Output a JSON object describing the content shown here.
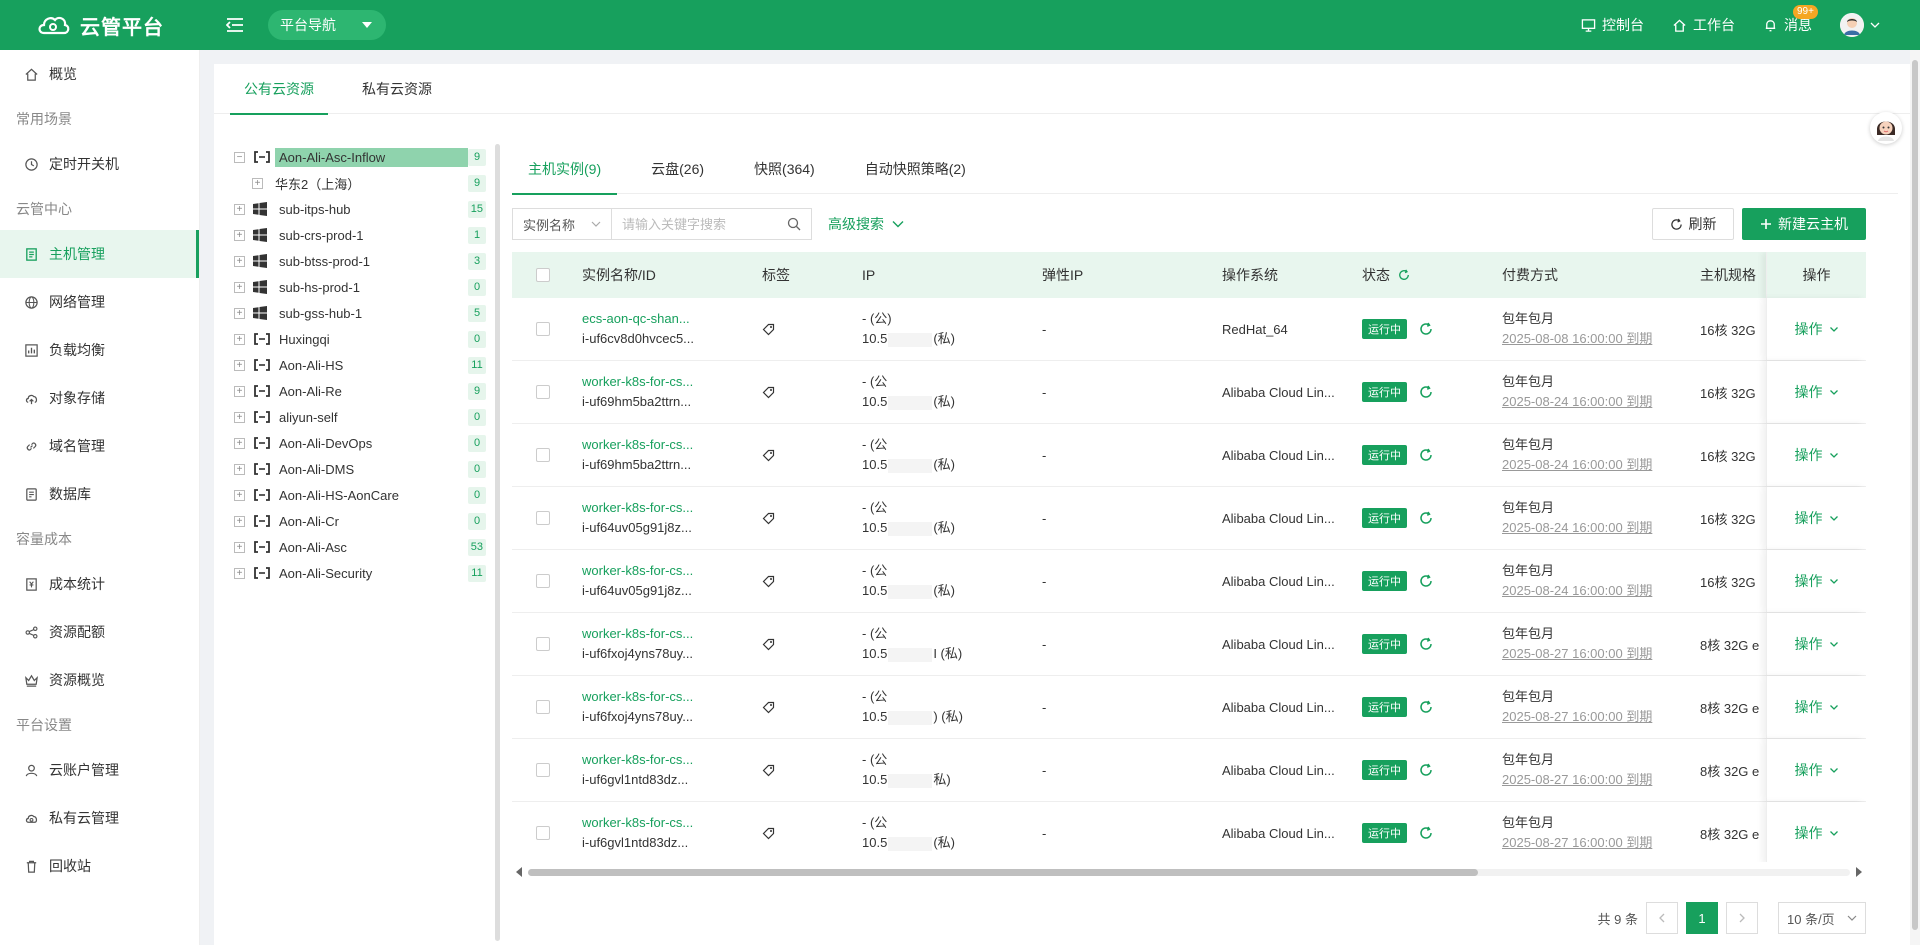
{
  "app": {
    "title": "云管平台",
    "nav_dropdown": "平台导航"
  },
  "top_links": {
    "console": "控制台",
    "workbench": "工作台",
    "messages": "消息",
    "badge": "99+"
  },
  "sidebar": {
    "overview": "概览",
    "group1": "常用场景",
    "scheduled": "定时开关机",
    "group2": "云管中心",
    "host_mgmt": "主机管理",
    "network": "网络管理",
    "lb": "负载均衡",
    "oss": "对象存储",
    "domain": "域名管理",
    "db": "数据库",
    "group3": "容量成本",
    "cost": "成本统计",
    "quota": "资源配额",
    "res_overview": "资源概览",
    "group4": "平台设置",
    "account": "云账户管理",
    "private": "私有云管理",
    "recycle": "回收站"
  },
  "main_tabs": {
    "public": "公有云资源",
    "private": "私有云资源"
  },
  "tree": [
    {
      "label": "Aon-Ali-Asc-Inflow",
      "count": "9",
      "icon": "aliyun-icon",
      "pm": "−"
    },
    {
      "label": "华东2（上海）",
      "count": "9",
      "icon": "",
      "pm": "+"
    },
    {
      "label": "sub-itps-hub",
      "count": "15",
      "icon": "windows-icon",
      "pm": "+"
    },
    {
      "label": "sub-crs-prod-1",
      "count": "1",
      "icon": "windows-icon",
      "pm": "+"
    },
    {
      "label": "sub-btss-prod-1",
      "count": "3",
      "icon": "windows-icon",
      "pm": "+"
    },
    {
      "label": "sub-hs-prod-1",
      "count": "0",
      "icon": "windows-icon",
      "pm": "+"
    },
    {
      "label": "sub-gss-hub-1",
      "count": "5",
      "icon": "windows-icon",
      "pm": "+"
    },
    {
      "label": "Huxingqi",
      "count": "0",
      "icon": "aliyun-icon",
      "pm": "+"
    },
    {
      "label": "Aon-Ali-HS",
      "count": "11",
      "icon": "aliyun-icon",
      "pm": "+"
    },
    {
      "label": "Aon-Ali-Re",
      "count": "9",
      "icon": "aliyun-icon",
      "pm": "+"
    },
    {
      "label": "aliyun-self",
      "count": "0",
      "icon": "aliyun-icon",
      "pm": "+"
    },
    {
      "label": "Aon-Ali-DevOps",
      "count": "0",
      "icon": "aliyun-icon",
      "pm": "+"
    },
    {
      "label": "Aon-Ali-DMS",
      "count": "0",
      "icon": "aliyun-icon",
      "pm": "+"
    },
    {
      "label": "Aon-Ali-HS-AonCare",
      "count": "0",
      "icon": "aliyun-icon",
      "pm": "+"
    },
    {
      "label": "Aon-Ali-Cr",
      "count": "0",
      "icon": "aliyun-icon",
      "pm": "+"
    },
    {
      "label": "Aon-Ali-Asc",
      "count": "53",
      "icon": "aliyun-icon",
      "pm": "+"
    },
    {
      "label": "Aon-Ali-Security",
      "count": "11",
      "icon": "aliyun-icon",
      "pm": "+"
    }
  ],
  "inner_tabs": {
    "host": "主机实例(9)",
    "disk": "云盘(26)",
    "snapshot": "快照(364)",
    "policy": "自动快照策略(2)"
  },
  "toolbar": {
    "select": "实例名称",
    "placeholder": "请输入关键字搜索",
    "advanced": "高级搜索",
    "refresh": "刷新",
    "new_host": "新建云主机"
  },
  "table": {
    "headers": {
      "name": "实例名称/ID",
      "tag": "标签",
      "ip": "IP",
      "eip": "弹性IP",
      "os": "操作系统",
      "status": "状态",
      "pay": "付费方式",
      "spec": "主机规格",
      "op": "操作"
    },
    "rows": [
      {
        "name": "ecs-aon-qc-shan...",
        "id": "i-uf6cv8d0hvcec5...",
        "ip1": "- (公)",
        "ip2a": "10.5",
        "ip2b": "(私)",
        "eip": "-",
        "os": "RedHat_64",
        "status": "运行中",
        "pay": "包年包月",
        "expire": "2025-08-08 16:00:00 到期",
        "spec": "16核 32G",
        "op": "操作"
      },
      {
        "name": "worker-k8s-for-cs...",
        "id": "i-uf69hm5ba2ttrn...",
        "ip1": "- (公",
        "ip2a": "10.5",
        "ip2b": "(私)",
        "eip": "-",
        "os": "Alibaba Cloud Lin...",
        "status": "运行中",
        "pay": "包年包月",
        "expire": "2025-08-24 16:00:00 到期",
        "spec": "16核 32G",
        "op": "操作"
      },
      {
        "name": "worker-k8s-for-cs...",
        "id": "i-uf69hm5ba2ttrn...",
        "ip1": "- (公",
        "ip2a": "10.5",
        "ip2b": "(私)",
        "eip": "-",
        "os": "Alibaba Cloud Lin...",
        "status": "运行中",
        "pay": "包年包月",
        "expire": "2025-08-24 16:00:00 到期",
        "spec": "16核 32G",
        "op": "操作"
      },
      {
        "name": "worker-k8s-for-cs...",
        "id": "i-uf64uv05g91j8z...",
        "ip1": "- (公",
        "ip2a": "10.5",
        "ip2b": "(私)",
        "eip": "-",
        "os": "Alibaba Cloud Lin...",
        "status": "运行中",
        "pay": "包年包月",
        "expire": "2025-08-24 16:00:00 到期",
        "spec": "16核 32G",
        "op": "操作"
      },
      {
        "name": "worker-k8s-for-cs...",
        "id": "i-uf64uv05g91j8z...",
        "ip1": "- (公",
        "ip2a": "10.5",
        "ip2b": "(私)",
        "eip": "-",
        "os": "Alibaba Cloud Lin...",
        "status": "运行中",
        "pay": "包年包月",
        "expire": "2025-08-24 16:00:00 到期",
        "spec": "16核 32G",
        "op": "操作"
      },
      {
        "name": "worker-k8s-for-cs...",
        "id": "i-uf6fxoj4yns78uy...",
        "ip1": "- (公",
        "ip2a": "10.5",
        "ip2b": "I (私)",
        "eip": "-",
        "os": "Alibaba Cloud Lin...",
        "status": "运行中",
        "pay": "包年包月",
        "expire": "2025-08-27 16:00:00 到期",
        "spec": "8核 32G e",
        "op": "操作"
      },
      {
        "name": "worker-k8s-for-cs...",
        "id": "i-uf6fxoj4yns78uy...",
        "ip1": "- (公",
        "ip2a": "10.5",
        "ip2b": ") (私)",
        "eip": "-",
        "os": "Alibaba Cloud Lin...",
        "status": "运行中",
        "pay": "包年包月",
        "expire": "2025-08-27 16:00:00 到期",
        "spec": "8核 32G e",
        "op": "操作"
      },
      {
        "name": "worker-k8s-for-cs...",
        "id": "i-uf6gvl1ntd83dz...",
        "ip1": "- (公",
        "ip2a": "10.5",
        "ip2b": "私)",
        "eip": "-",
        "os": "Alibaba Cloud Lin...",
        "status": "运行中",
        "pay": "包年包月",
        "expire": "2025-08-27 16:00:00 到期",
        "spec": "8核 32G e",
        "op": "操作"
      },
      {
        "name": "worker-k8s-for-cs...",
        "id": "i-uf6gvl1ntd83dz...",
        "ip1": "- (公",
        "ip2a": "10.5",
        "ip2b": "(私)",
        "eip": "-",
        "os": "Alibaba Cloud Lin...",
        "status": "运行中",
        "pay": "包年包月",
        "expire": "2025-08-27 16:00:00 到期",
        "spec": "8核 32G e",
        "op": "操作"
      }
    ]
  },
  "pager": {
    "total": "共 9 条",
    "current": "1",
    "size": "10 条/页"
  },
  "colors": {
    "primary": "#17a05d",
    "light": "#e8f6ee",
    "badge": "#f5a623"
  }
}
